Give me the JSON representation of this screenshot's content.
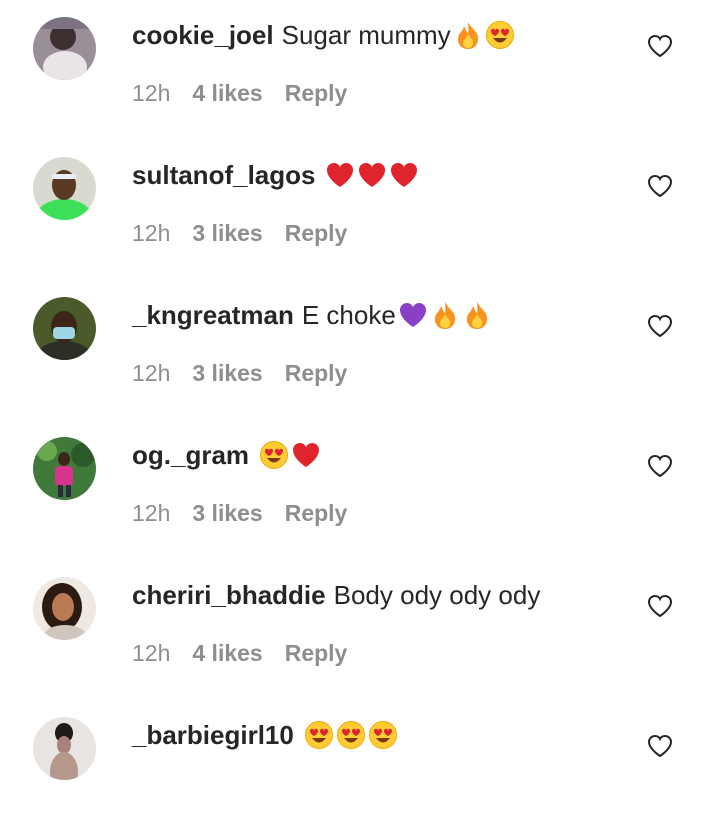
{
  "comments": [
    {
      "username": "cookie_joel",
      "text": "Sugar mummy",
      "emojis": [
        "fire-emoji",
        "heart-eyes-emoji"
      ],
      "time": "12h",
      "likes": "4 likes",
      "reply": "Reply",
      "avatar": "avatar-photo"
    },
    {
      "username": "sultanof_lagos",
      "text": "",
      "emojis": [
        "red-heart-emoji",
        "red-heart-emoji",
        "red-heart-emoji"
      ],
      "time": "12h",
      "likes": "3 likes",
      "reply": "Reply",
      "avatar": "avatar-photo"
    },
    {
      "username": "_kngreatman",
      "text": "E choke",
      "emojis": [
        "purple-heart-emoji",
        "fire-emoji",
        "fire-emoji"
      ],
      "time": "12h",
      "likes": "3 likes",
      "reply": "Reply",
      "avatar": "avatar-photo"
    },
    {
      "username": "og._gram",
      "text": "",
      "emojis": [
        "heart-eyes-emoji",
        "red-heart-emoji"
      ],
      "time": "12h",
      "likes": "3 likes",
      "reply": "Reply",
      "avatar": "avatar-photo"
    },
    {
      "username": "cheriri_bhaddie",
      "text": "Body ody ody ody",
      "emojis": [],
      "time": "12h",
      "likes": "4 likes",
      "reply": "Reply",
      "avatar": "avatar-photo"
    },
    {
      "username": "_barbiegirl10",
      "text": "",
      "emojis": [
        "heart-eyes-emoji",
        "heart-eyes-emoji",
        "heart-eyes-emoji"
      ],
      "time": "",
      "likes": "",
      "reply": "",
      "avatar": "avatar-photo"
    }
  ],
  "colors": {
    "text": "#262626",
    "meta": "#8e8e8e",
    "heart_red": "#e0242e",
    "purple_heart": "#8a3fc7",
    "fire_orange": "#f7931e"
  }
}
